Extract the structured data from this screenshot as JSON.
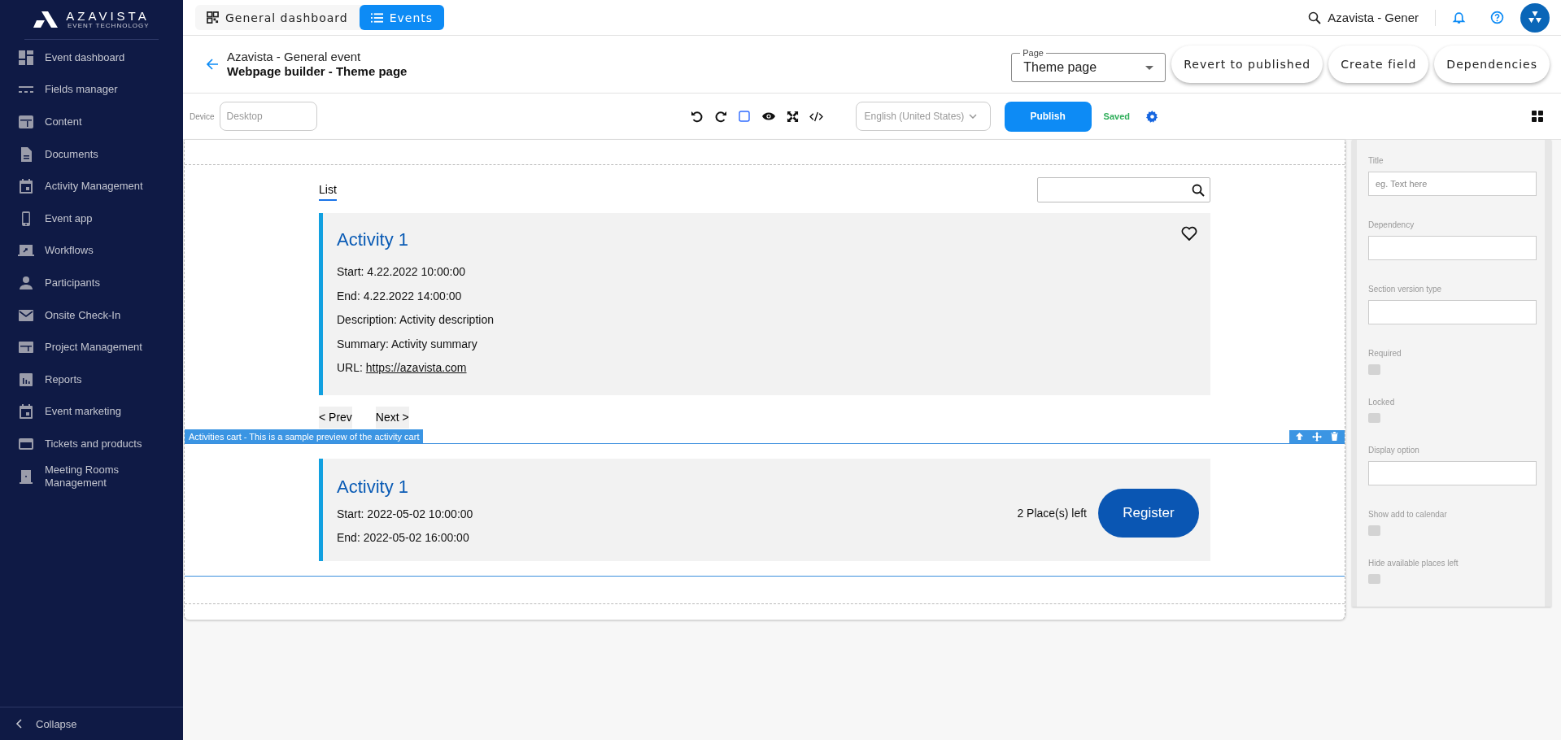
{
  "sidebar": {
    "logo": {
      "name": "AZAVISTA",
      "tagline": "EVENT TECHNOLOGY"
    },
    "items": [
      {
        "label": "Event dashboard"
      },
      {
        "label": "Fields manager"
      },
      {
        "label": "Content"
      },
      {
        "label": "Documents"
      },
      {
        "label": "Activity Management"
      },
      {
        "label": "Event app"
      },
      {
        "label": "Workflows"
      },
      {
        "label": "Participants"
      },
      {
        "label": "Onsite Check-In"
      },
      {
        "label": "Project Management"
      },
      {
        "label": "Reports"
      },
      {
        "label": "Event marketing"
      },
      {
        "label": "Tickets and products"
      },
      {
        "label": "Meeting Rooms Management"
      }
    ],
    "collapse": {
      "label": "Collapse"
    }
  },
  "top_bar": {
    "tabs": [
      {
        "label": "General dashboard",
        "selected": false
      },
      {
        "label": "Events",
        "selected": true
      }
    ],
    "search": {
      "value": "Azavista - Gener"
    }
  },
  "header": {
    "event_name": "Azavista - General event",
    "page_title": "Webpage builder - Theme page",
    "page_select": {
      "label": "Page",
      "value": "Theme page"
    },
    "buttons": [
      "Revert to published",
      "Create field",
      "Dependencies"
    ]
  },
  "toolbar": {
    "device": {
      "label": "Device",
      "placeholder": "Desktop"
    },
    "language": {
      "value": "English (United States)",
      "disabled": true
    },
    "publish": "Publish",
    "status": "Saved"
  },
  "canvas": {
    "tabs": [
      {
        "label": "List",
        "selected": true
      }
    ],
    "activity_card": {
      "title": "Activity 1",
      "lines": [
        {
          "text": "Start: 4.22.2022 10:00:00"
        },
        {
          "text": "End: 4.22.2022 14:00:00"
        },
        {
          "text": "Description: Activity description"
        },
        {
          "text": "Summary: Activity summary"
        },
        {
          "text": "URL: ",
          "link": "https://azavista.com"
        }
      ]
    },
    "pager": [
      "< Prev",
      "Next >"
    ],
    "section_label": "Activities cart - This is a sample preview of the activity cart",
    "cart_card": {
      "title": "Activity 1",
      "lines": [
        "Start: 2022-05-02 10:00:00",
        "End: 2022-05-02 16:00:00"
      ],
      "places": "2 Place(s) left",
      "button": "Register"
    }
  },
  "properties": {
    "fields": [
      {
        "kind": "text",
        "label": "Title",
        "placeholder": "eg. Text here"
      },
      {
        "kind": "text",
        "label": "Dependency"
      },
      {
        "kind": "text",
        "label": "Section version type"
      },
      {
        "kind": "checkbox",
        "label": "Required",
        "checked": false
      },
      {
        "kind": "checkbox",
        "label": "Locked",
        "checked": false
      },
      {
        "kind": "text",
        "label": "Display option"
      },
      {
        "kind": "checkbox",
        "label": "Show add to calendar",
        "checked": false
      },
      {
        "kind": "checkbox",
        "label": "Hide available places left",
        "checked": false
      }
    ]
  }
}
